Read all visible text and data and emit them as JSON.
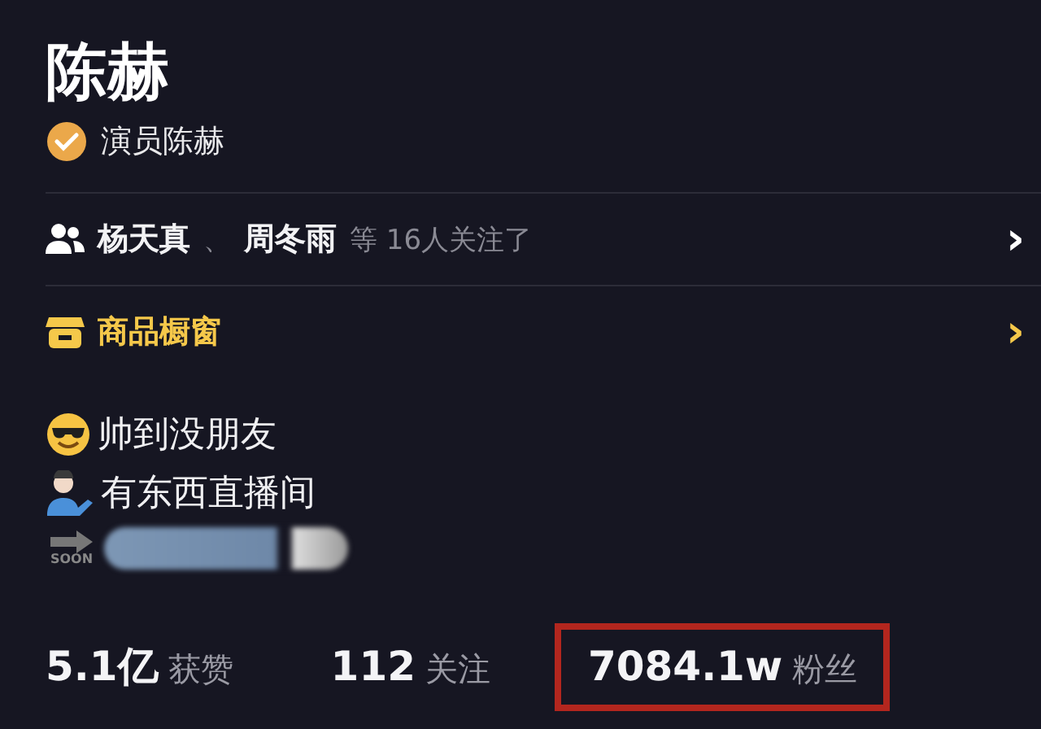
{
  "profile": {
    "name": "陈赫",
    "verification": "演员陈赫"
  },
  "followed_by": {
    "names": [
      "杨天真",
      "周冬雨"
    ],
    "separator": "、",
    "suffix": "等 16人关注了",
    "chevron": "›"
  },
  "shop": {
    "label": "商品橱窗",
    "chevron": "›"
  },
  "bio": [
    {
      "kind": "sunglasses",
      "text": "帅到没朋友"
    },
    {
      "kind": "person",
      "text": "有东西直播间"
    },
    {
      "kind": "soon",
      "text": "SOON"
    }
  ],
  "stats": [
    {
      "value": "5.1亿",
      "label": "获赞",
      "highlighted": false
    },
    {
      "value": "112",
      "label": "关注",
      "highlighted": false
    },
    {
      "value": "7084.1w",
      "label": "粉丝",
      "highlighted": true
    }
  ]
}
